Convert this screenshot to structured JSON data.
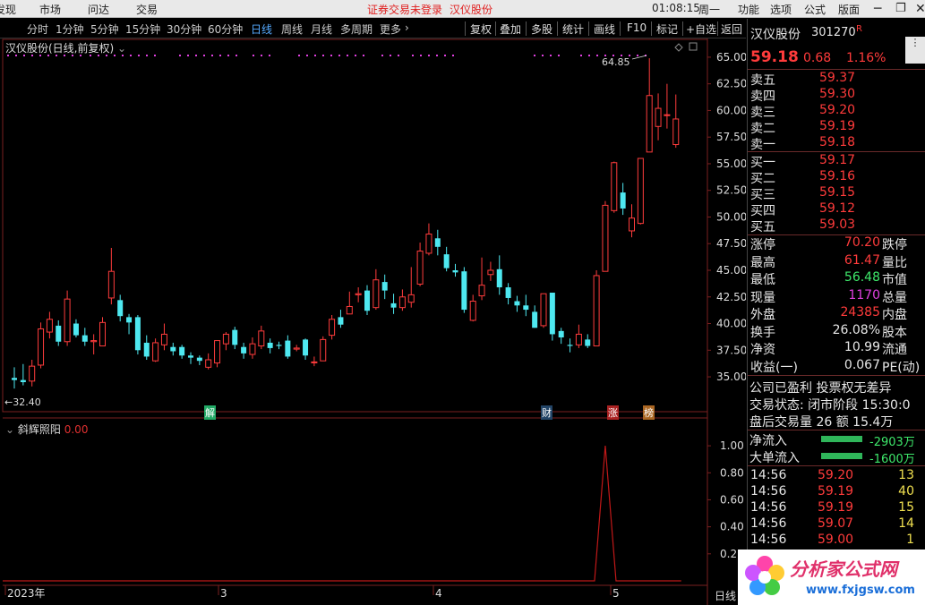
{
  "topbar": {
    "left": [
      "发现",
      "市场",
      "问达",
      "交易"
    ],
    "notice": "证券交易未登录",
    "stock": "汉仪股份",
    "time": "01:08:15",
    "weekday": "周一",
    "right": [
      "功能",
      "选项",
      "公式",
      "版面"
    ]
  },
  "periods": [
    "分时",
    "1分钟",
    "5分钟",
    "15分钟",
    "30分钟",
    "60分钟",
    "日线",
    "周线",
    "月线",
    "多周期",
    "更多"
  ],
  "active_period": "日线",
  "tools": [
    "复权",
    "叠加",
    "多股",
    "统计",
    "画线",
    "F10",
    "标记",
    "+自选",
    "返回"
  ],
  "main_title": "汉仪股份(日线,前复权)",
  "price_axis": [
    "65.00",
    "62.50",
    "60.00",
    "57.50",
    "55.00",
    "52.50",
    "50.00",
    "47.50",
    "45.00",
    "42.50",
    "40.00",
    "37.50",
    "35.00"
  ],
  "max_label": "64.85",
  "min_label": "32.40",
  "event_marks": [
    "解",
    "财",
    "涨",
    "榜"
  ],
  "indicator": {
    "name": "斜辉照阳",
    "value": "0.00",
    "axis": [
      "1.00",
      "0.80",
      "0.60",
      "0.40",
      "0.2"
    ]
  },
  "x_axis": [
    "2023年",
    "3",
    "4",
    "5"
  ],
  "bottom_tab": "日线",
  "quote": {
    "name": "汉仪股份",
    "code": "301270",
    "suffix": "R",
    "price": "59.18",
    "change": "0.68",
    "pct": "1.16%",
    "asks": [
      {
        "label": "卖五",
        "price": "59.37"
      },
      {
        "label": "卖四",
        "price": "59.30"
      },
      {
        "label": "卖三",
        "price": "59.20"
      },
      {
        "label": "卖二",
        "price": "59.19"
      },
      {
        "label": "卖一",
        "price": "59.18"
      }
    ],
    "bids": [
      {
        "label": "买一",
        "price": "59.17"
      },
      {
        "label": "买二",
        "price": "59.16"
      },
      {
        "label": "买三",
        "price": "59.15"
      },
      {
        "label": "买四",
        "price": "59.12"
      },
      {
        "label": "买五",
        "price": "59.03"
      }
    ],
    "stats": [
      {
        "l": "涨停",
        "v": "70.20",
        "c": "red",
        "r": "跌停"
      },
      {
        "l": "最高",
        "v": "61.47",
        "c": "red",
        "r": "量比"
      },
      {
        "l": "最低",
        "v": "56.48",
        "c": "green",
        "r": "市值"
      },
      {
        "l": "现量",
        "v": "1170",
        "c": "mag",
        "r": "总量"
      },
      {
        "l": "外盘",
        "v": "24385",
        "c": "red",
        "r": "内盘"
      },
      {
        "l": "换手",
        "v": "26.08%",
        "c": "white",
        "r": "股本"
      },
      {
        "l": "净资",
        "v": "10.99",
        "c": "white",
        "r": "流通"
      },
      {
        "l": "收益(一)",
        "v": "0.067",
        "c": "white",
        "r": "PE(动)"
      }
    ],
    "info1": "公司已盈利 投票权无差异",
    "info2": "交易状态: 闭市阶段 15:30:0",
    "info3": "盘后交易量 26 额 15.4万",
    "flows": [
      {
        "label": "净流入",
        "value": "-2903万"
      },
      {
        "label": "大单流入",
        "value": "-1600万"
      }
    ],
    "ticks": [
      {
        "t": "14:56",
        "p": "59.20",
        "v": "13"
      },
      {
        "t": "14:56",
        "p": "59.19",
        "v": "40"
      },
      {
        "t": "14:56",
        "p": "59.19",
        "v": "15"
      },
      {
        "t": "14:56",
        "p": "59.07",
        "v": "14"
      },
      {
        "t": "14:56",
        "p": "59.00",
        "v": "1"
      }
    ]
  },
  "watermark": {
    "name": "分析家公式网",
    "url": "www.fxjgsw.com"
  },
  "chart_data": {
    "type": "candlestick",
    "ylim": [
      32.4,
      66.0
    ],
    "candles": [
      [
        34.9,
        34.7,
        35.9,
        33.9
      ],
      [
        34.7,
        34.5,
        36.2,
        34.2
      ],
      [
        34.6,
        36.0,
        36.6,
        34.1
      ],
      [
        36.1,
        39.5,
        40.1,
        35.8
      ],
      [
        39.2,
        40.4,
        41.1,
        38.6
      ],
      [
        39.8,
        38.3,
        40.3,
        37.9
      ],
      [
        38.3,
        42.3,
        43.1,
        37.9
      ],
      [
        40.0,
        38.9,
        40.4,
        38.7
      ],
      [
        38.9,
        38.3,
        39.6,
        37.9
      ],
      [
        38.3,
        38.4,
        39.0,
        37.1
      ],
      [
        37.9,
        40.1,
        40.6,
        37.9
      ],
      [
        42.4,
        44.9,
        47.1,
        41.8
      ],
      [
        42.2,
        40.7,
        42.7,
        40.2
      ],
      [
        40.6,
        40.1,
        40.9,
        39.0
      ],
      [
        40.6,
        37.5,
        40.8,
        37.1
      ],
      [
        38.2,
        36.9,
        38.9,
        36.6
      ],
      [
        36.5,
        38.2,
        38.6,
        36.4
      ],
      [
        38.0,
        39.0,
        40.0,
        37.5
      ],
      [
        37.8,
        37.4,
        38.2,
        37.0
      ],
      [
        37.8,
        37.0,
        38.0,
        36.7
      ],
      [
        37.0,
        36.8,
        37.3,
        36.2
      ],
      [
        36.8,
        36.5,
        37.0,
        36.1
      ],
      [
        35.9,
        36.6,
        37.2,
        35.7
      ],
      [
        36.3,
        38.4,
        38.4,
        35.9
      ],
      [
        38.1,
        39.0,
        39.2,
        37.5
      ],
      [
        39.4,
        38.0,
        39.7,
        37.6
      ],
      [
        37.8,
        37.2,
        38.2,
        36.7
      ],
      [
        37.1,
        38.1,
        38.7,
        36.7
      ],
      [
        37.9,
        39.3,
        39.8,
        37.6
      ],
      [
        38.2,
        37.7,
        38.6,
        37.2
      ],
      [
        38.0,
        37.9,
        38.3,
        37.6
      ],
      [
        38.4,
        36.9,
        38.9,
        36.7
      ],
      [
        37.6,
        37.7,
        38.0,
        37.4
      ],
      [
        38.5,
        37.0,
        38.6,
        36.6
      ],
      [
        36.4,
        36.4,
        36.9,
        36.0
      ],
      [
        36.5,
        38.5,
        38.8,
        36.5
      ],
      [
        38.9,
        40.4,
        40.8,
        38.5
      ],
      [
        40.6,
        39.9,
        41.3,
        39.6
      ],
      [
        40.9,
        41.6,
        43.0,
        40.9
      ],
      [
        42.7,
        42.8,
        43.4,
        42.0
      ],
      [
        43.1,
        41.2,
        43.6,
        40.8
      ],
      [
        41.5,
        44.1,
        45.1,
        41.3
      ],
      [
        43.9,
        43.1,
        44.6,
        42.3
      ],
      [
        41.9,
        41.5,
        42.8,
        40.9
      ],
      [
        41.5,
        42.5,
        43.2,
        41.2
      ],
      [
        42.0,
        42.7,
        45.3,
        41.5
      ],
      [
        43.7,
        46.8,
        47.6,
        43.5
      ],
      [
        46.6,
        48.4,
        49.4,
        46.4
      ],
      [
        48.0,
        47.2,
        48.8,
        46.4
      ],
      [
        46.5,
        45.2,
        47.2,
        44.9
      ],
      [
        45.0,
        44.8,
        45.6,
        44.4
      ],
      [
        44.9,
        41.3,
        45.3,
        41.0
      ],
      [
        40.3,
        42.1,
        42.7,
        40.2
      ],
      [
        42.6,
        43.6,
        46.2,
        42.2
      ],
      [
        44.6,
        45.0,
        45.8,
        44.0
      ],
      [
        45.1,
        43.4,
        46.4,
        42.7
      ],
      [
        43.4,
        42.4,
        43.8,
        41.8
      ],
      [
        42.1,
        41.7,
        42.6,
        41.1
      ],
      [
        41.7,
        41.3,
        42.7,
        40.7
      ],
      [
        41.1,
        39.6,
        41.7,
        39.6
      ],
      [
        39.8,
        42.8,
        42.8,
        39.6
      ],
      [
        42.9,
        39.0,
        42.9,
        38.4
      ],
      [
        39.3,
        38.7,
        39.6,
        38.1
      ],
      [
        38.0,
        37.9,
        38.6,
        37.3
      ],
      [
        38.0,
        39.0,
        39.9,
        37.7
      ],
      [
        38.5,
        37.9,
        39.0,
        37.7
      ],
      [
        37.9,
        44.5,
        45.0,
        37.9
      ],
      [
        44.9,
        51.1,
        51.5,
        44.9
      ],
      [
        50.6,
        55.1,
        55.2,
        50.4
      ],
      [
        52.3,
        50.8,
        53.2,
        50.2
      ],
      [
        48.7,
        49.9,
        51.2,
        48.1
      ],
      [
        49.4,
        55.5,
        55.5,
        49.3
      ],
      [
        56.1,
        61.4,
        64.9,
        56.1
      ],
      [
        58.5,
        60.2,
        61.6,
        57.2
      ],
      [
        59.6,
        59.6,
        62.5,
        58.3
      ],
      [
        56.8,
        59.2,
        61.5,
        56.5
      ]
    ],
    "indicator": {
      "name": "斜辉照阳",
      "peak": 1.0,
      "ylim": [
        0,
        1.1
      ]
    }
  }
}
